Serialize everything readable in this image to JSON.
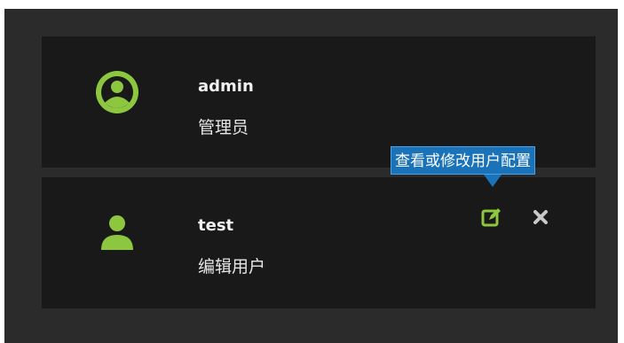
{
  "users": [
    {
      "name": "admin",
      "role": "管理员",
      "avatar_icon": "user-circle-icon"
    },
    {
      "name": "test",
      "role": "编辑用户",
      "avatar_icon": "user-icon",
      "actions": {
        "edit_icon": "edit-icon",
        "delete_icon": "close-icon"
      }
    }
  ],
  "tooltip": {
    "text": "查看或修改用户配置"
  },
  "colors": {
    "accent": "#8dc63f",
    "panel": "#2b2b2b",
    "row": "#191919",
    "tooltip": "#1a73b8",
    "delete_icon": "#c8c8c8"
  }
}
